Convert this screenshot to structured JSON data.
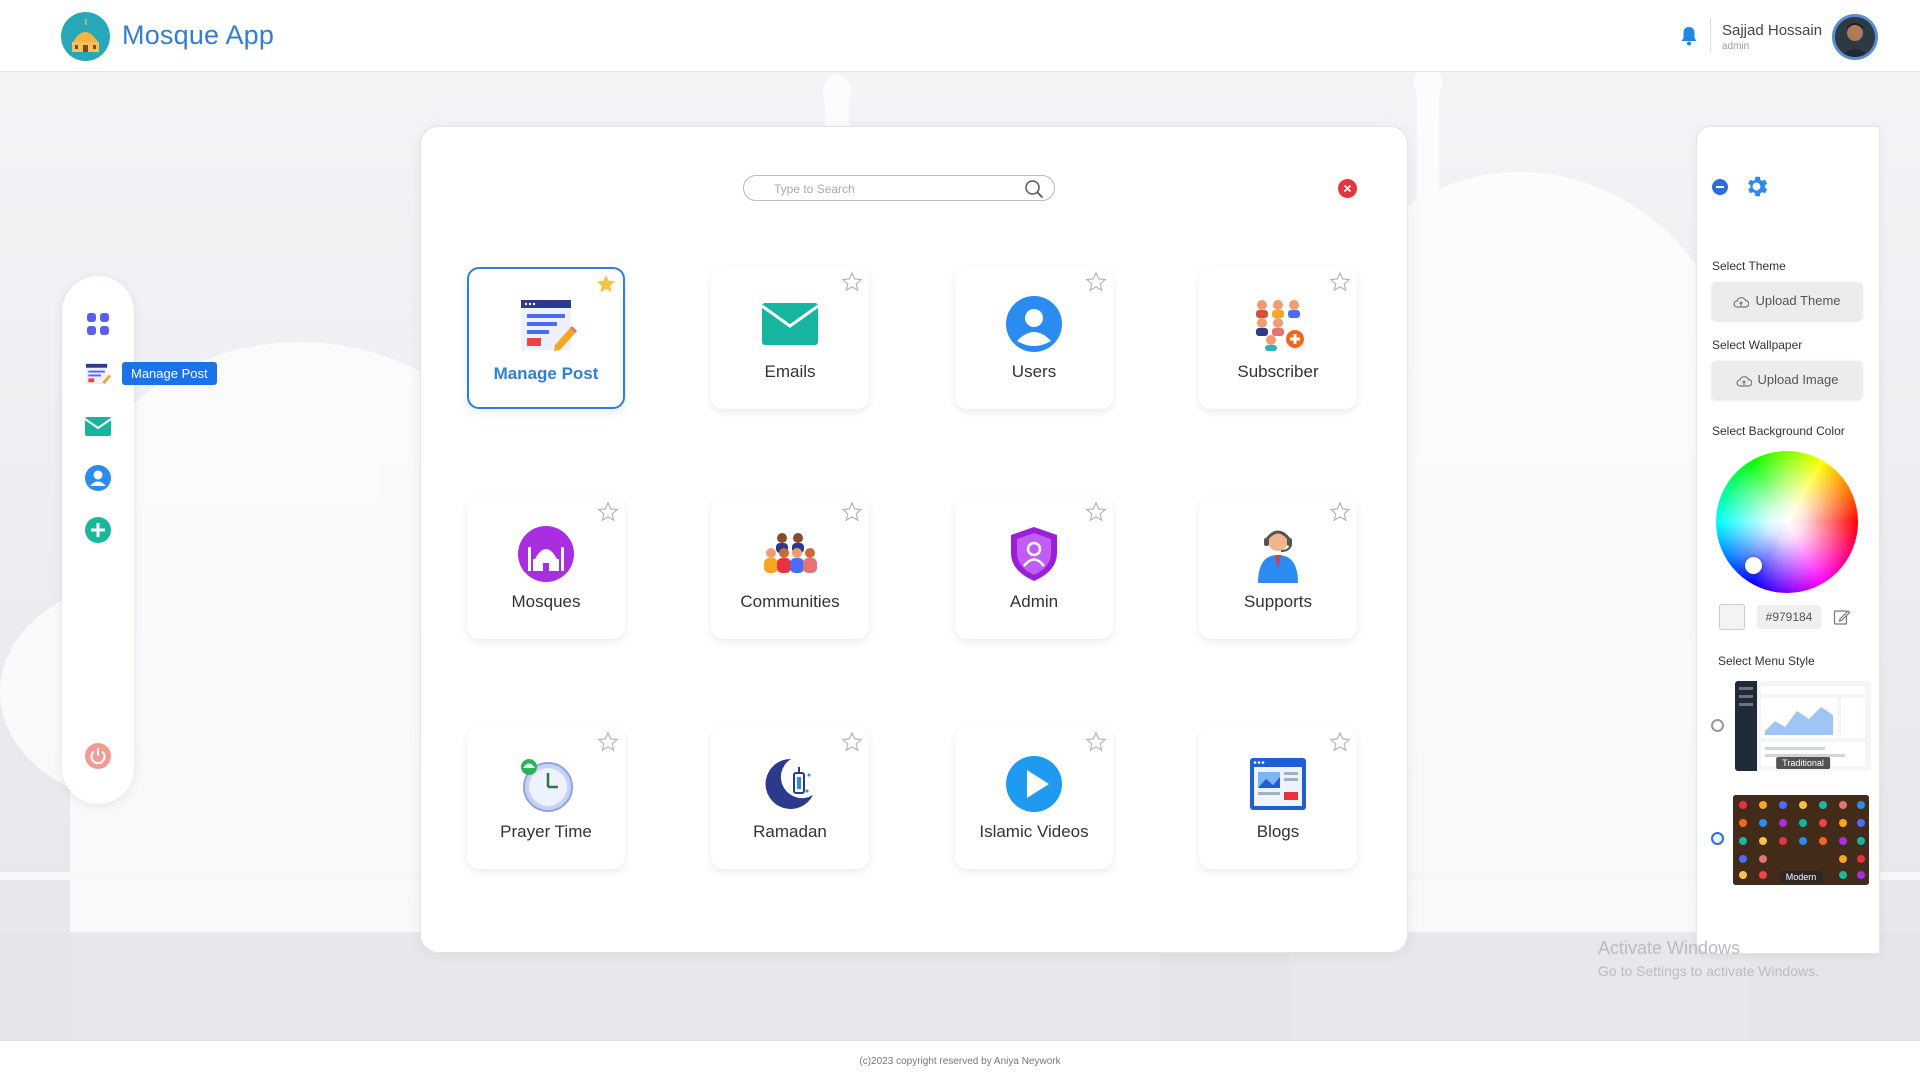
{
  "header": {
    "app_title": "Mosque App",
    "logo_icon": "mosque-logo-icon",
    "notification_icon": "bell-icon",
    "user": {
      "name": "Sajjad Hossain",
      "role": "admin"
    }
  },
  "dock": {
    "items": [
      {
        "icon": "apps-grid-icon",
        "label": ""
      },
      {
        "icon": "manage-post-icon",
        "label": "Manage Post"
      },
      {
        "icon": "email-icon",
        "label": ""
      },
      {
        "icon": "user-icon",
        "label": ""
      },
      {
        "icon": "add-icon",
        "label": ""
      }
    ],
    "tooltip": "Manage Post",
    "power_icon": "power-icon"
  },
  "launcher": {
    "search_placeholder": "Type to Search",
    "tiles": [
      {
        "label": "Manage Post",
        "icon": "manage-post-icon",
        "favorite": true,
        "active": true
      },
      {
        "label": "Emails",
        "icon": "email-icon",
        "favorite": false
      },
      {
        "label": "Users",
        "icon": "user-icon",
        "favorite": false
      },
      {
        "label": "Subscriber",
        "icon": "subscriber-icon",
        "favorite": false
      },
      {
        "label": "Mosques",
        "icon": "mosque-icon",
        "favorite": false
      },
      {
        "label": "Communities",
        "icon": "communities-icon",
        "favorite": false
      },
      {
        "label": "Admin",
        "icon": "admin-shield-icon",
        "favorite": false
      },
      {
        "label": "Supports",
        "icon": "support-agent-icon",
        "favorite": false
      },
      {
        "label": "Prayer Time",
        "icon": "clock-icon",
        "favorite": false
      },
      {
        "label": "Ramadan",
        "icon": "crescent-lantern-icon",
        "favorite": false
      },
      {
        "label": "Islamic Videos",
        "icon": "play-icon",
        "favorite": false
      },
      {
        "label": "Blogs",
        "icon": "blog-icon",
        "favorite": false
      }
    ]
  },
  "settings": {
    "theme_label": "Select Theme",
    "theme_button": "Upload Theme",
    "wallpaper_label": "Select Wallpaper",
    "wallpaper_button": "Upload Image",
    "bg_color_label": "Select Background Color",
    "bg_color_value": "#979184",
    "menu_style_label": "Select Menu Style",
    "menu_styles": [
      {
        "name": "Traditional",
        "selected": false
      },
      {
        "name": "Modern",
        "selected": true
      }
    ]
  },
  "watermark": {
    "title": "Activate Windows",
    "subtitle": "Go to Settings to activate Windows."
  },
  "footer": {
    "copyright": "(c)2023 copyright reserved by Aniya Neywork"
  },
  "colors": {
    "accent": "#2f7fd6",
    "tooltip": "#1a73e8",
    "close": "#e8323f",
    "logo": "#28a7b9"
  }
}
